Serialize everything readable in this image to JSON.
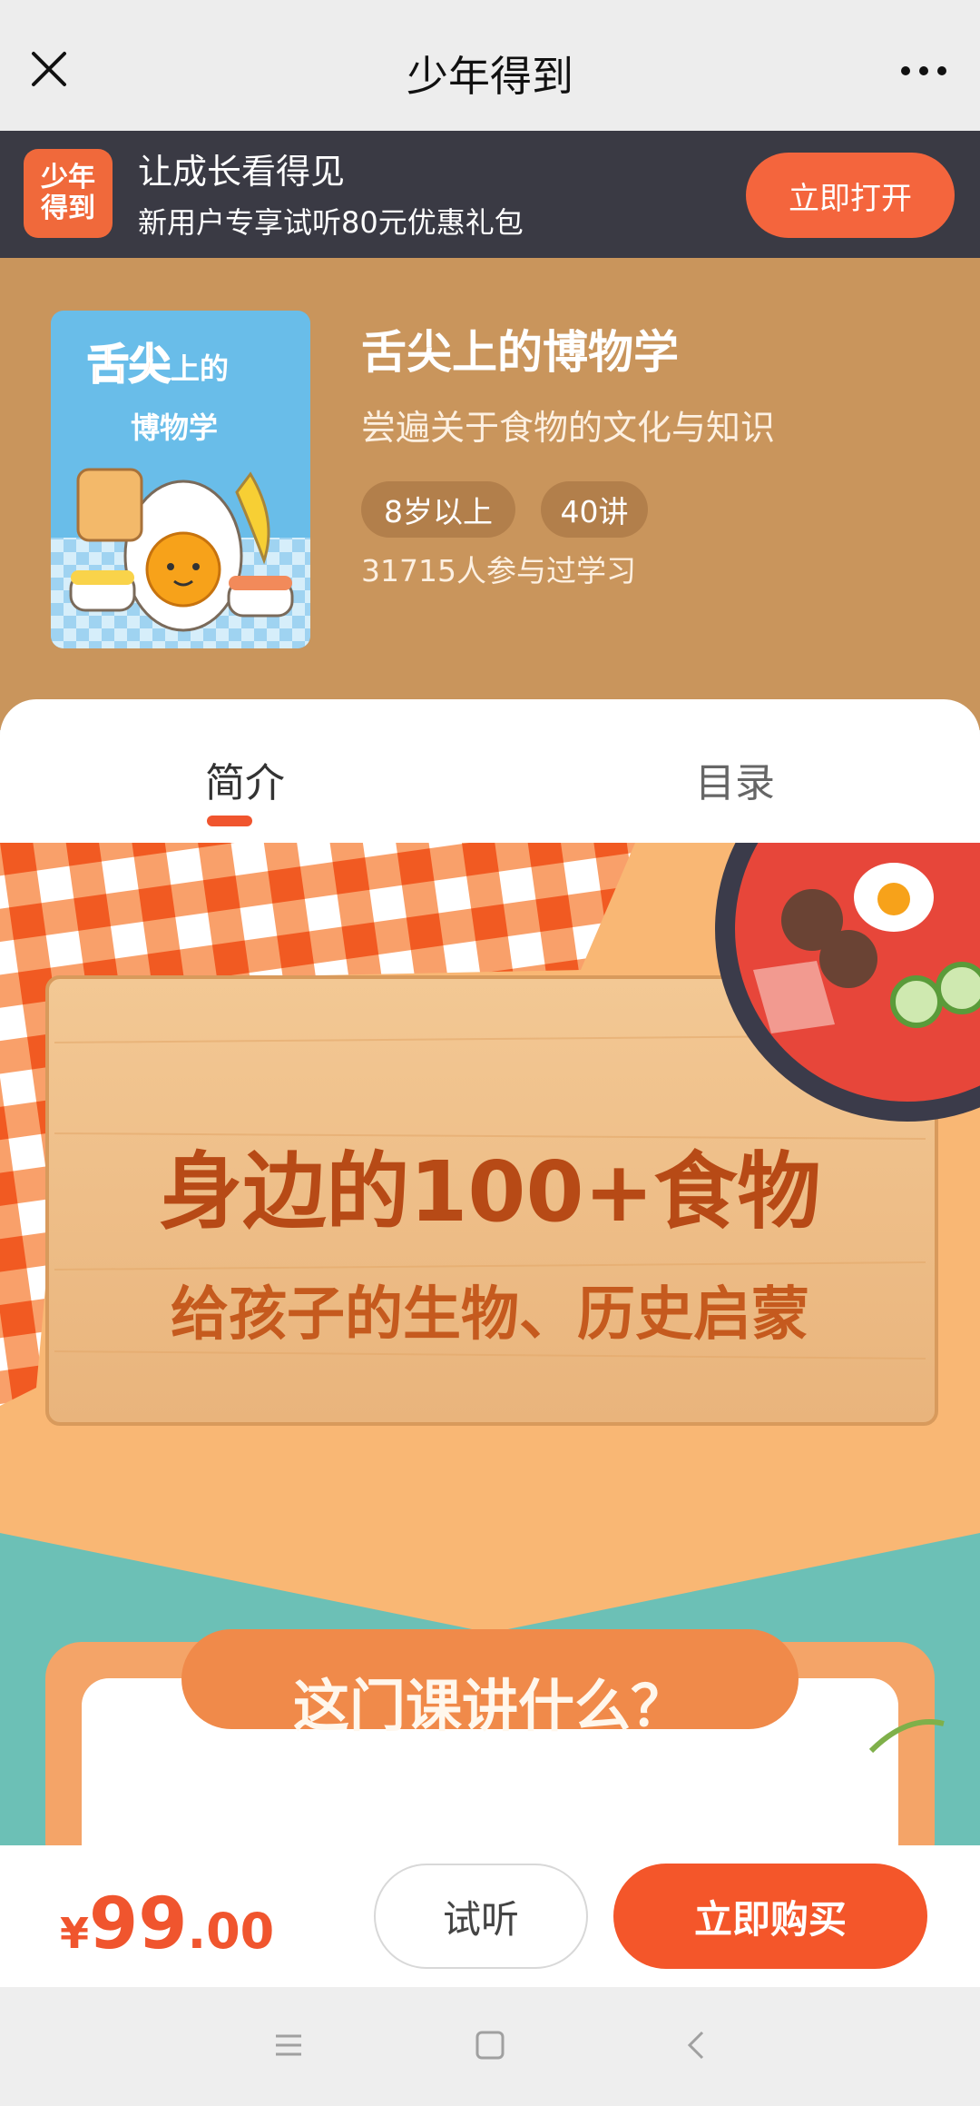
{
  "topbar": {
    "title": "少年得到"
  },
  "promo": {
    "logo_line1": "少年",
    "logo_line2": "得到",
    "title": "让成长看得见",
    "subtitle": "新用户专享试听80元优惠礼包",
    "open_label": "立即打开"
  },
  "course": {
    "cover": {
      "title_line1": "舌尖上的",
      "title_line2": "博物学"
    },
    "name": "舌尖上的博物学",
    "description": "尝遍关于食物的文化与知识",
    "tags": [
      "8岁以上",
      "40讲"
    ],
    "learners": "31715人参与过学习"
  },
  "tabs": [
    {
      "label": "简介",
      "active": true
    },
    {
      "label": "目录",
      "active": false
    }
  ],
  "hero": {
    "headline": "身边的100+食物",
    "subheadline": "给孩子的生物、历史启蒙",
    "section_title": "这门课讲什么？"
  },
  "purchase": {
    "currency": "¥",
    "price_int": "99",
    "price_dec": ".00",
    "trial_label": "试听",
    "buy_label": "立即购买"
  },
  "colors": {
    "accent": "#f4562a",
    "header_bg": "#c9955c",
    "promo_bg": "#3a3a44"
  }
}
